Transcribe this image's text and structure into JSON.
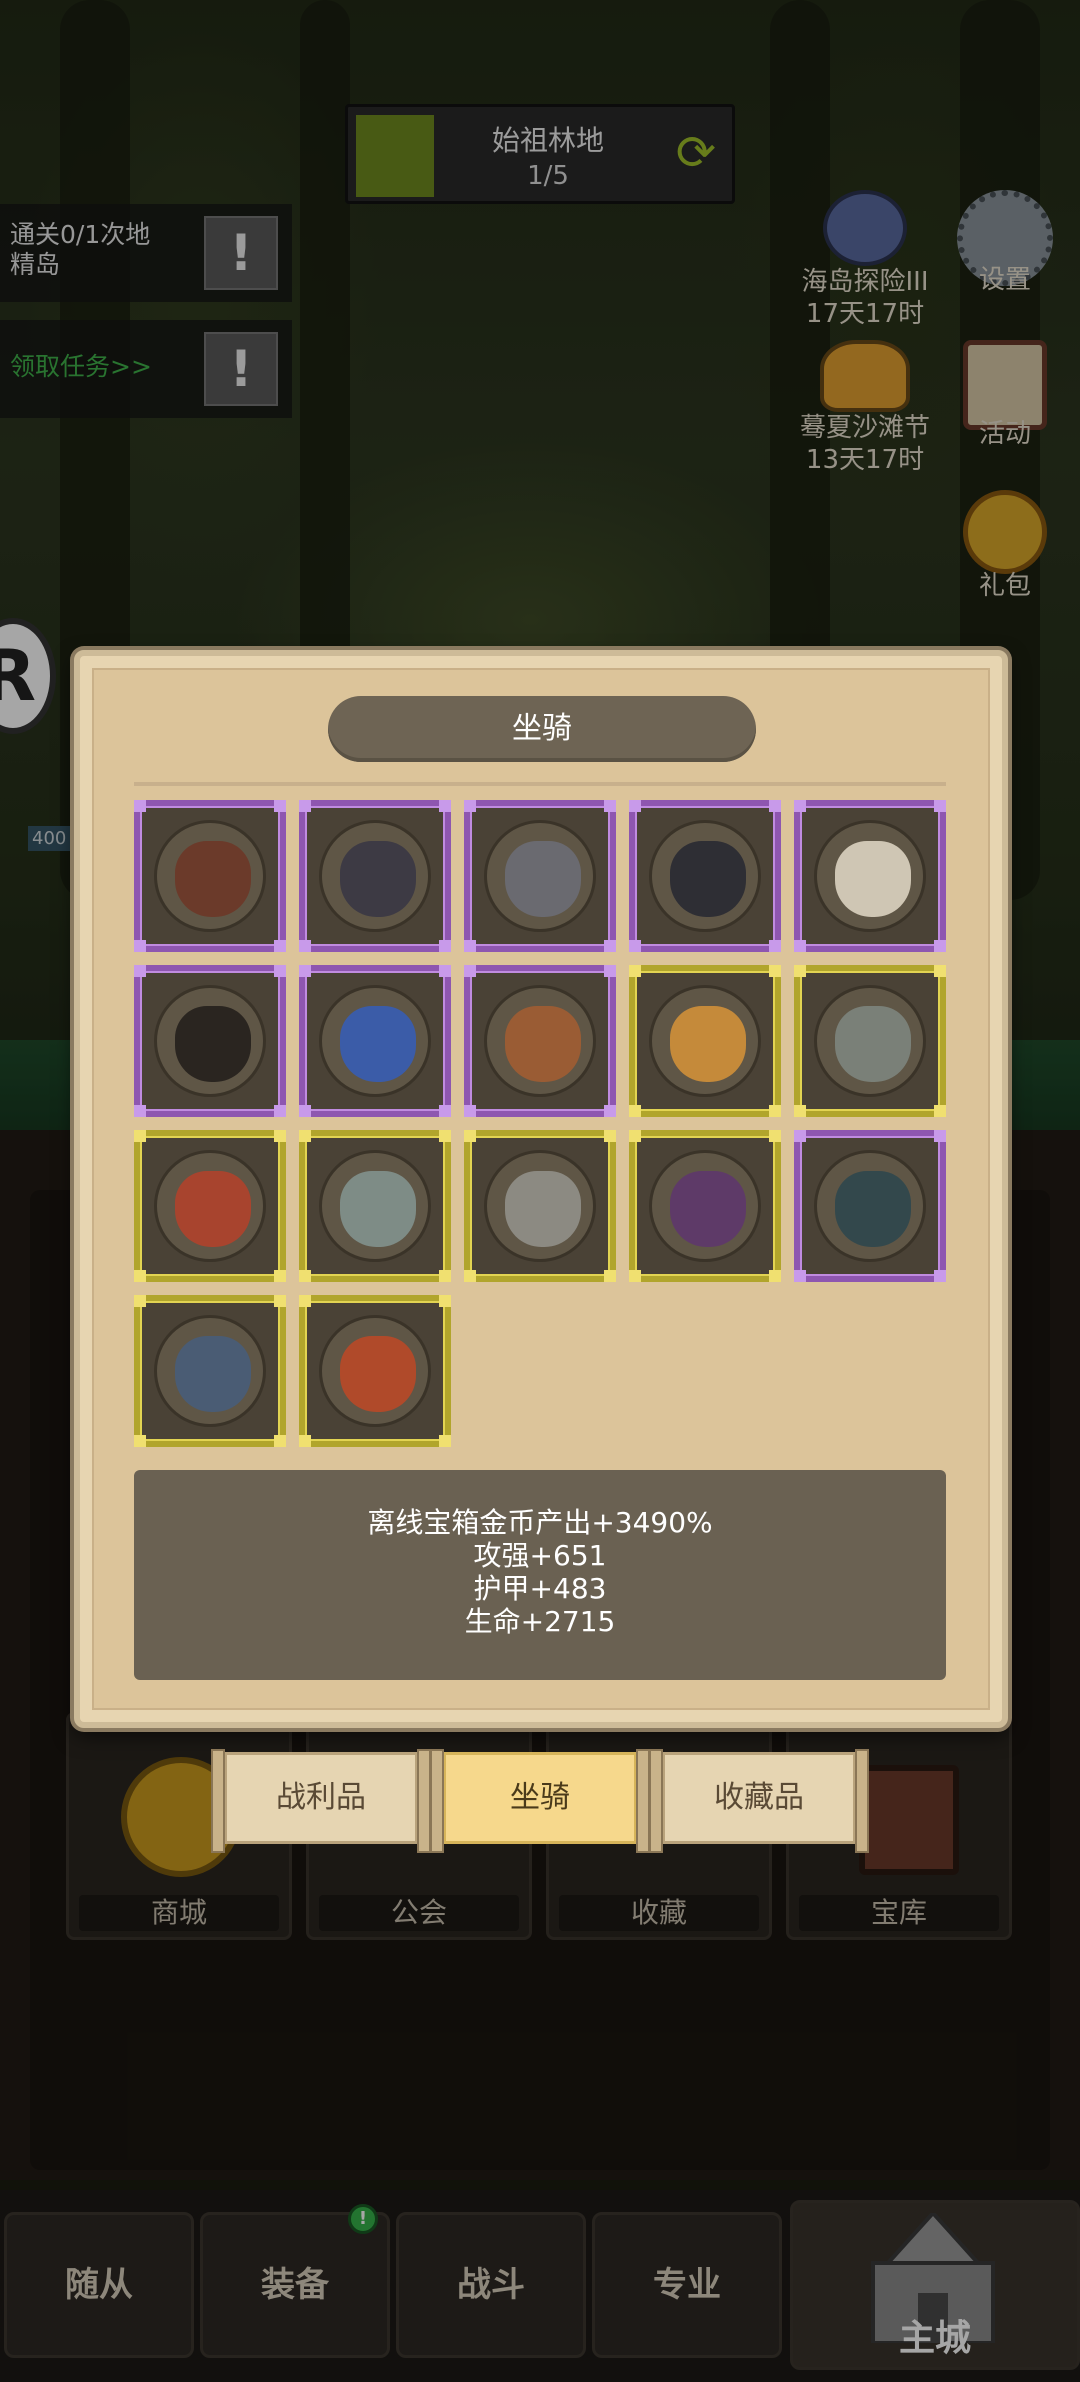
{
  "location": {
    "name": "始祖林地",
    "progress": "1/5"
  },
  "quests": [
    {
      "text_line1": "通关0/1次地",
      "text_line2": "精岛",
      "icon": "exclamation-icon"
    },
    {
      "text": "领取任务>>",
      "icon": "exclamation-icon"
    }
  ],
  "side_events": [
    {
      "name": "海岛探险III",
      "timer": "17天17时",
      "icon": "anchor-icon"
    },
    {
      "name": "蓦夏沙滩节",
      "timer": "13天17时",
      "icon": "beach-hat-icon"
    }
  ],
  "side_buttons": [
    {
      "label": "设置",
      "icon": "gear-icon"
    },
    {
      "label": "活动",
      "icon": "calendar-icon"
    },
    {
      "label": "礼包",
      "icon": "gift-coin-icon"
    }
  ],
  "r_badge": "R",
  "hp_num": "400",
  "modal": {
    "title": "坐骑",
    "mounts": [
      {
        "rarity": "purple",
        "icon": "horse-mount-icon",
        "color": "#6b3a2a"
      },
      {
        "rarity": "purple",
        "icon": "dark-beast-mount-icon",
        "color": "#3d3a44"
      },
      {
        "rarity": "purple",
        "icon": "armored-beast-mount-icon",
        "color": "#6a6a70"
      },
      {
        "rarity": "purple",
        "icon": "dark-wolf-mount-icon",
        "color": "#2e2e34"
      },
      {
        "rarity": "purple",
        "icon": "white-eagle-mount-icon",
        "color": "#cfc6b4"
      },
      {
        "rarity": "purple",
        "icon": "black-bear-mount-icon",
        "color": "#2a2520"
      },
      {
        "rarity": "purple",
        "icon": "blue-lion-mount-icon",
        "color": "#3b5ca8"
      },
      {
        "rarity": "purple",
        "icon": "brown-bear-mount-icon",
        "color": "#9a5c34"
      },
      {
        "rarity": "gold",
        "icon": "golden-lion-mount-icon",
        "color": "#c58a3a"
      },
      {
        "rarity": "gold",
        "icon": "stone-golem-mount-icon",
        "color": "#7a8078"
      },
      {
        "rarity": "gold",
        "icon": "mech-mount-icon",
        "color": "#a8442e"
      },
      {
        "rarity": "gold",
        "icon": "grey-dragon-mount-icon",
        "color": "#7e8c86"
      },
      {
        "rarity": "gold",
        "icon": "stone-beast-mount-icon",
        "color": "#8c8a82"
      },
      {
        "rarity": "gold",
        "icon": "purple-raptor-mount-icon",
        "color": "#5e3a68"
      },
      {
        "rarity": "purple",
        "icon": "teal-beast-mount-icon",
        "color": "#33484c"
      },
      {
        "rarity": "gold",
        "icon": "shark-mount-icon",
        "color": "#4a5c74"
      },
      {
        "rarity": "gold",
        "icon": "crab-mount-icon",
        "color": "#b04a2a"
      }
    ],
    "stats": [
      "离线宝箱金币产出+3490%",
      "攻强+651",
      "护甲+483",
      "生命+2715"
    ]
  },
  "tabs": [
    {
      "label": "战利品",
      "active": false
    },
    {
      "label": "坐骑",
      "active": true
    },
    {
      "label": "收藏品",
      "active": false
    }
  ],
  "cards": [
    "商城",
    "公会",
    "收藏",
    "宝库"
  ],
  "bottom_nav": [
    {
      "label": "随从"
    },
    {
      "label": "装备",
      "badge": "!"
    },
    {
      "label": "战斗"
    },
    {
      "label": "专业"
    },
    {
      "label": "主城",
      "active": true
    }
  ]
}
